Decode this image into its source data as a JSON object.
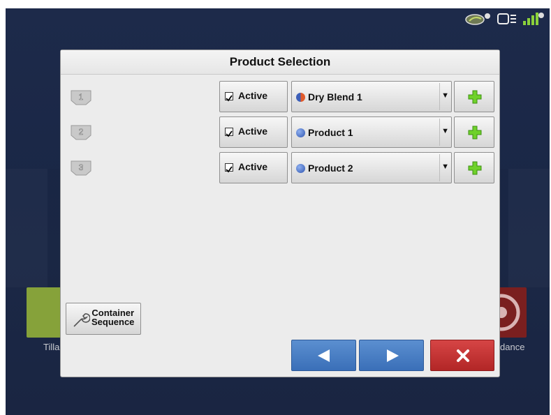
{
  "dialog": {
    "title": "Product Selection"
  },
  "rows": [
    {
      "number": "1",
      "active_label": "Active",
      "active_checked": true,
      "product": "Dry Blend 1",
      "product_icon": "blend-dot-icon"
    },
    {
      "number": "2",
      "active_label": "Active",
      "active_checked": true,
      "product": "Product 1",
      "product_icon": "product-dot-icon"
    },
    {
      "number": "3",
      "active_label": "Active",
      "active_checked": true,
      "product": "Product 2",
      "product_icon": "product-dot-icon"
    }
  ],
  "container_sequence": {
    "line1": "Container",
    "line2": "Sequence"
  },
  "background": {
    "left_app_label": "Tilla",
    "right_app_label": "dance"
  },
  "status_icons": [
    "satellite-leaf-icon",
    "display-icon",
    "gps-signal-icon"
  ],
  "colors": {
    "nav_blue": "#4a7fc4",
    "cancel_red": "#c23131",
    "add_green": "#5fc21a"
  }
}
